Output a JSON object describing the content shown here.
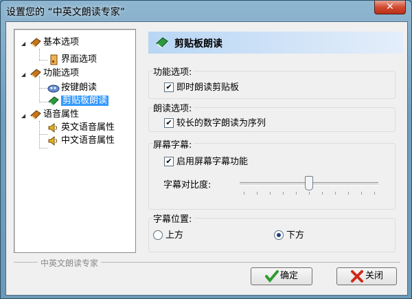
{
  "window": {
    "title": "设置您的 “中英文朗读专家”",
    "close_symbol": "✕"
  },
  "tree": {
    "nodes": [
      {
        "label": "基本选项"
      },
      {
        "label": "界面选项"
      },
      {
        "label": "功能选项"
      },
      {
        "label": "按键朗读"
      },
      {
        "label": "剪贴板朗读"
      },
      {
        "label": "语音属性"
      },
      {
        "label": "英文语音属性"
      },
      {
        "label": "中文语音属性"
      }
    ],
    "footer": "中英文朗读专家"
  },
  "panel": {
    "title": "剪贴板朗读"
  },
  "groups": {
    "function": {
      "label": "功能选项:",
      "checkbox": "即时朗读剪贴板",
      "checked": true
    },
    "reading": {
      "label": "朗读选项:",
      "checkbox": "较长的数字朗读为序列",
      "checked": true
    },
    "subtitle": {
      "label": "屏幕字幕:",
      "checkbox": "启用屏幕字幕功能",
      "checked": true,
      "contrast_label": "字幕对比度:",
      "contrast_value": 0.5
    },
    "position": {
      "label": "字幕位置:",
      "options": [
        "上方",
        "下方"
      ],
      "selected": "下方"
    }
  },
  "buttons": {
    "ok": "确定",
    "close": "关闭"
  },
  "colors": {
    "selection": "#3399ff",
    "header_bg": "#b8d6f4",
    "ok_icon": "#2e9a2e",
    "close_icon": "#d02818"
  }
}
